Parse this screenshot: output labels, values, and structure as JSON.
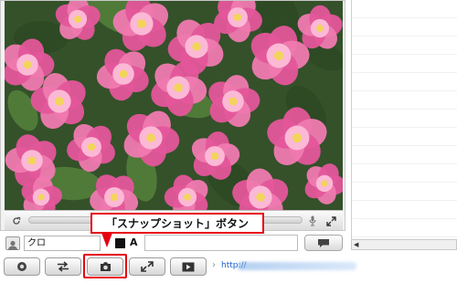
{
  "comment_bar": {
    "user_name": "クロ",
    "font_label": "A",
    "comment_value": ""
  },
  "toolbar": {
    "url_chevron": "›",
    "url_text": "http://"
  },
  "callout": {
    "label": "「スナップショット」ボタン"
  },
  "colors": {
    "highlight_red": "#e60012",
    "link_blue": "#1a5fd0",
    "rose_pink": "#ee5a9c",
    "leaf_green": "#3c5a2c"
  },
  "icons": {
    "video_controls": [
      "refresh-icon",
      "microphone-icon",
      "expand-icon"
    ],
    "comment_controls": [
      "user-icon",
      "color-swatch",
      "chat-bubble-icon"
    ],
    "toolbar": [
      "record-icon",
      "switch-arrows-icon",
      "snapshot-icon",
      "fullscreen-icon",
      "media-icon"
    ]
  }
}
